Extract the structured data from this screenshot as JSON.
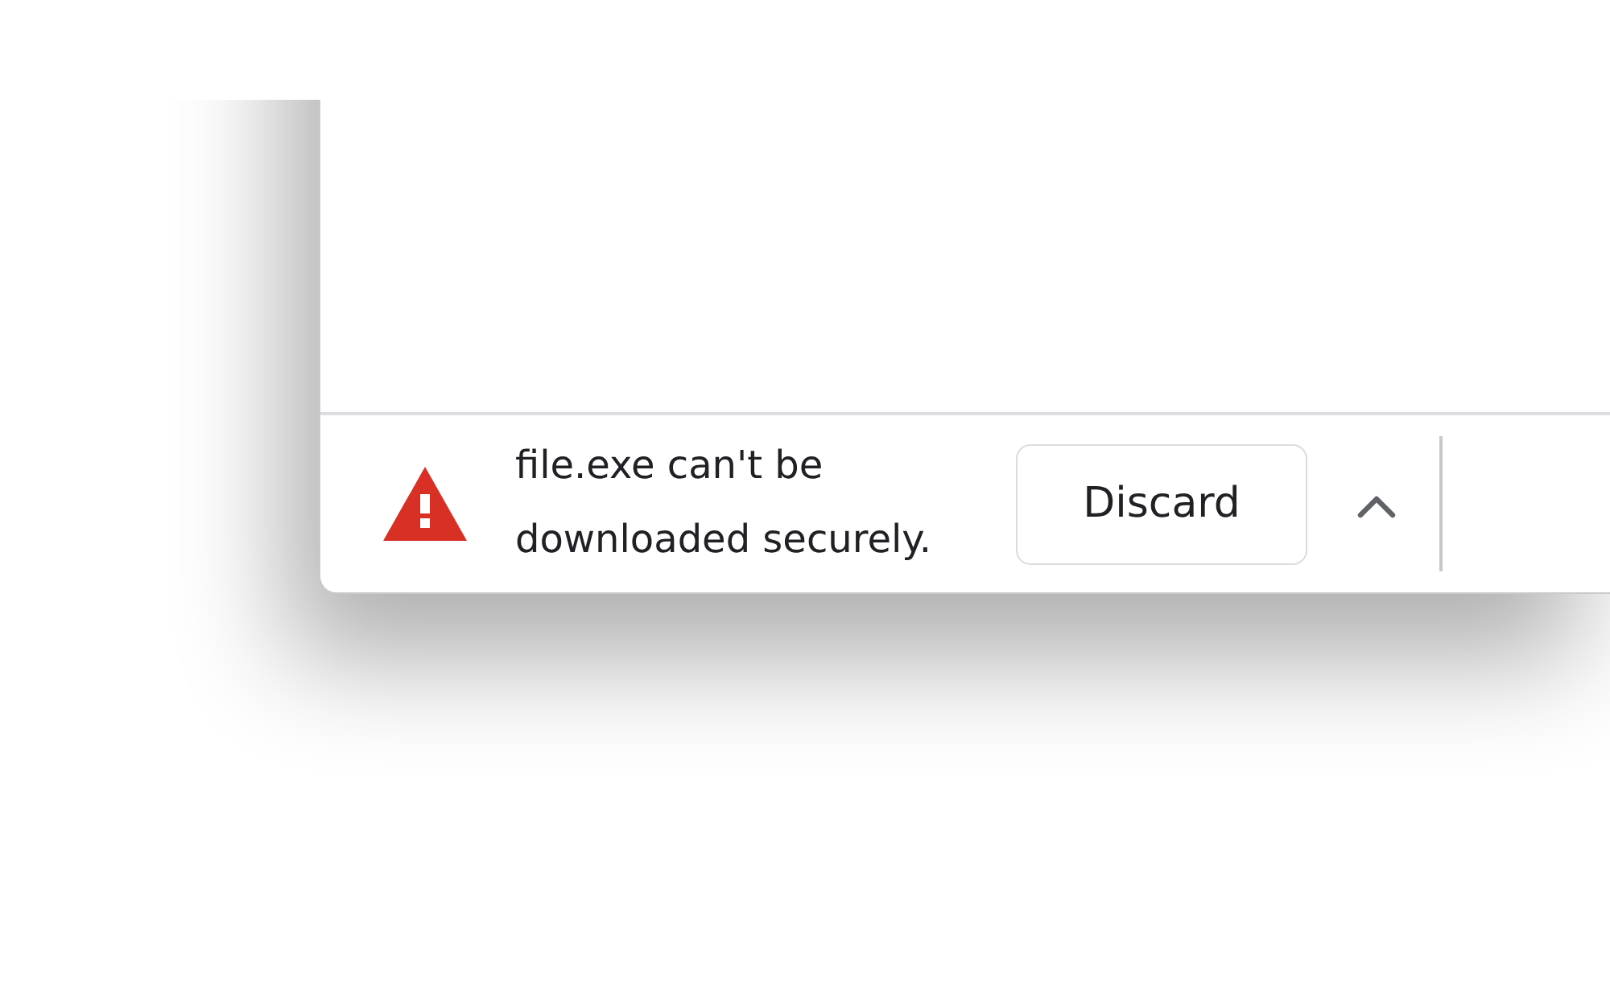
{
  "download_bar": {
    "message": "file.exe can't be downloaded securely.",
    "buttons": [
      {
        "label": "Discard"
      }
    ]
  }
}
